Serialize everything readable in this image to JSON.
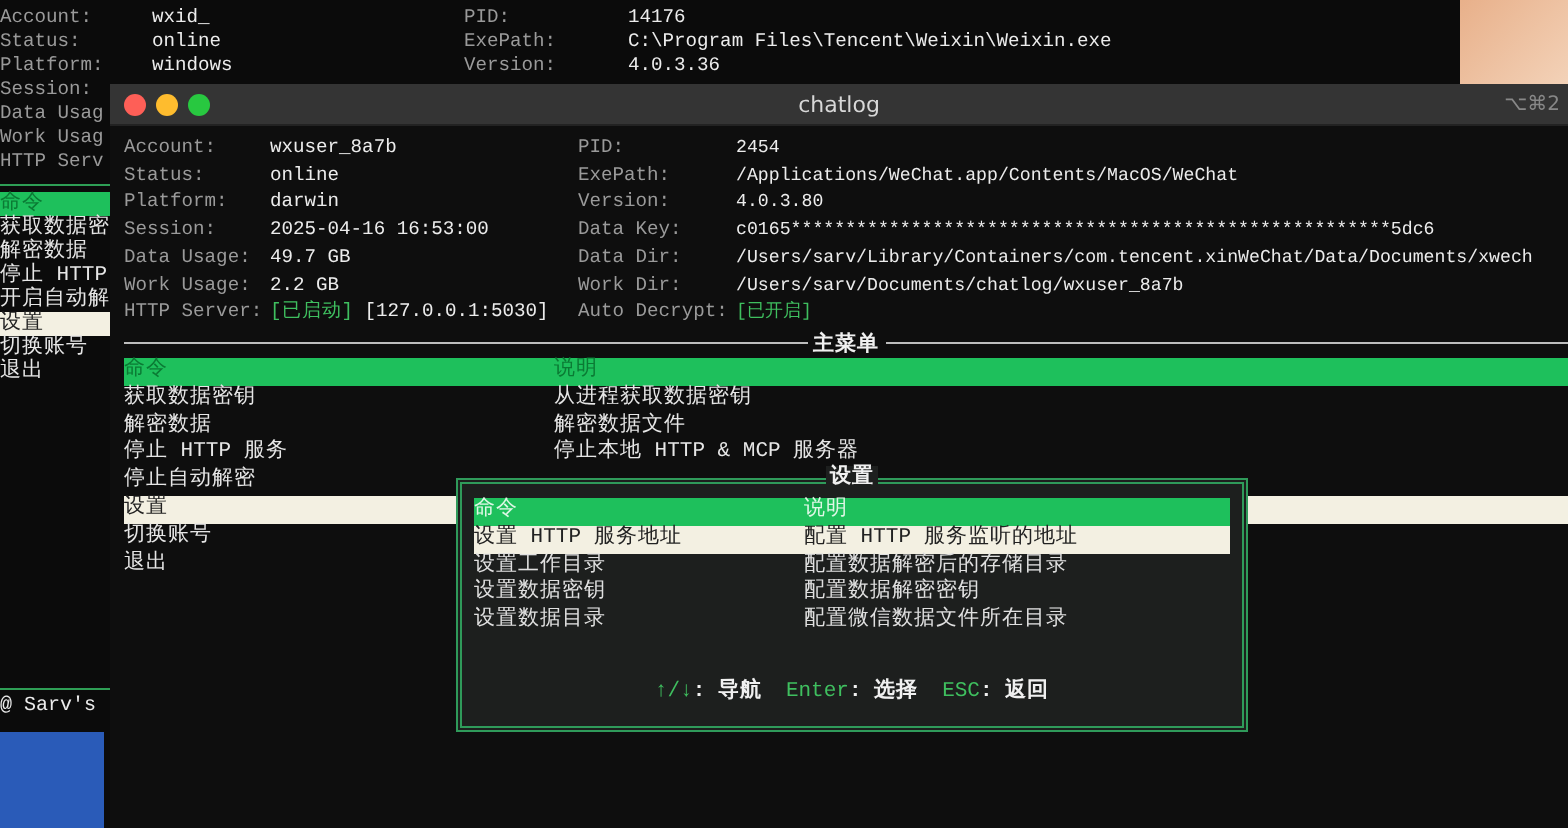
{
  "background_window": {
    "info_rows": [
      {
        "label": "Account:",
        "value": "wxid_",
        "label_2": "PID:",
        "value_2": "14176"
      },
      {
        "label": "Status:",
        "value": "online",
        "label_2": "ExePath:",
        "value_2": "C:\\Program Files\\Tencent\\Weixin\\Weixin.exe"
      },
      {
        "label": "Platform:",
        "value": "windows",
        "label_2": "Version:",
        "value_2": "4.0.3.36"
      }
    ],
    "cut_labels": [
      "Session:",
      "Data Usag",
      "Work Usag",
      "HTTP Serv"
    ],
    "menu": {
      "header": "命令",
      "items": [
        {
          "label": "获取数据密",
          "selected": false
        },
        {
          "label": "解密数据",
          "selected": false
        },
        {
          "label": "停止 HTTP",
          "selected": false
        },
        {
          "label": "开启自动解",
          "selected": false
        },
        {
          "label": "设置",
          "selected": true
        },
        {
          "label": "切换账号",
          "selected": false
        },
        {
          "label": "退出",
          "selected": false
        }
      ]
    },
    "footer": "@ Sarv's"
  },
  "window": {
    "title": "chatlog",
    "shortcut": "⌥⌘2",
    "info_rows": [
      {
        "label": "Account:",
        "value": "wxuser_8a7b",
        "label_2": "PID:",
        "value_2": "2454"
      },
      {
        "label": "Status:",
        "value": "online",
        "label_2": "ExePath:",
        "value_2": "/Applications/WeChat.app/Contents/MacOS/WeChat"
      },
      {
        "label": "Platform:",
        "value": "darwin",
        "label_2": "Version:",
        "value_2": "4.0.3.80"
      },
      {
        "label": "Session:",
        "value": "2025-04-16 16:53:00",
        "label_2": "Data Key:",
        "value_2": "c0165*******************************************************5dc6"
      },
      {
        "label": "Data Usage:",
        "value": "49.7 GB",
        "label_2": "Data Dir:",
        "value_2": "/Users/sarv/Library/Containers/com.tencent.xinWeChat/Data/Documents/xwech"
      },
      {
        "label": "Work Usage:",
        "value": "2.2 GB",
        "label_2": "Work Dir:",
        "value_2": "/Users/sarv/Documents/chatlog/wxuser_8a7b"
      },
      {
        "label": "HTTP Server:",
        "status": "[已启动]",
        "value": "[127.0.0.1:5030]",
        "label_2": "Auto Decrypt:",
        "status_2": "[已开启]"
      }
    ],
    "main_menu": {
      "title": "主菜单",
      "columns": [
        "命令",
        "说明"
      ],
      "items": [
        {
          "command": "获取数据密钥",
          "description": "从进程获取数据密钥",
          "selected": false
        },
        {
          "command": "解密数据",
          "description": "解密数据文件",
          "selected": false
        },
        {
          "command": "停止 HTTP 服务",
          "description": "停止本地 HTTP & MCP 服务器",
          "selected": false
        },
        {
          "command": "停止自动解密",
          "selected": false
        },
        {
          "command": "设置",
          "selected": true
        },
        {
          "command": "切换账号",
          "selected": false
        },
        {
          "command": "退出",
          "selected": false
        }
      ]
    },
    "dialog": {
      "title": "设置",
      "columns": [
        "命令",
        "说明"
      ],
      "items": [
        {
          "command": "设置 HTTP 服务地址",
          "description": "配置 HTTP 服务监听的地址",
          "selected": true
        },
        {
          "command": "设置工作目录",
          "description": "配置数据解密后的存储目录",
          "selected": false
        },
        {
          "command": "设置数据密钥",
          "description": "配置数据解密密钥",
          "selected": false
        },
        {
          "command": "设置数据目录",
          "description": "配置微信数据文件所在目录",
          "selected": false
        }
      ],
      "hints": [
        {
          "key": "↑/↓",
          "action": ": 导航"
        },
        {
          "key": "Enter",
          "action": ": 选择"
        },
        {
          "key": "ESC",
          "action": ": 返回"
        }
      ]
    }
  }
}
